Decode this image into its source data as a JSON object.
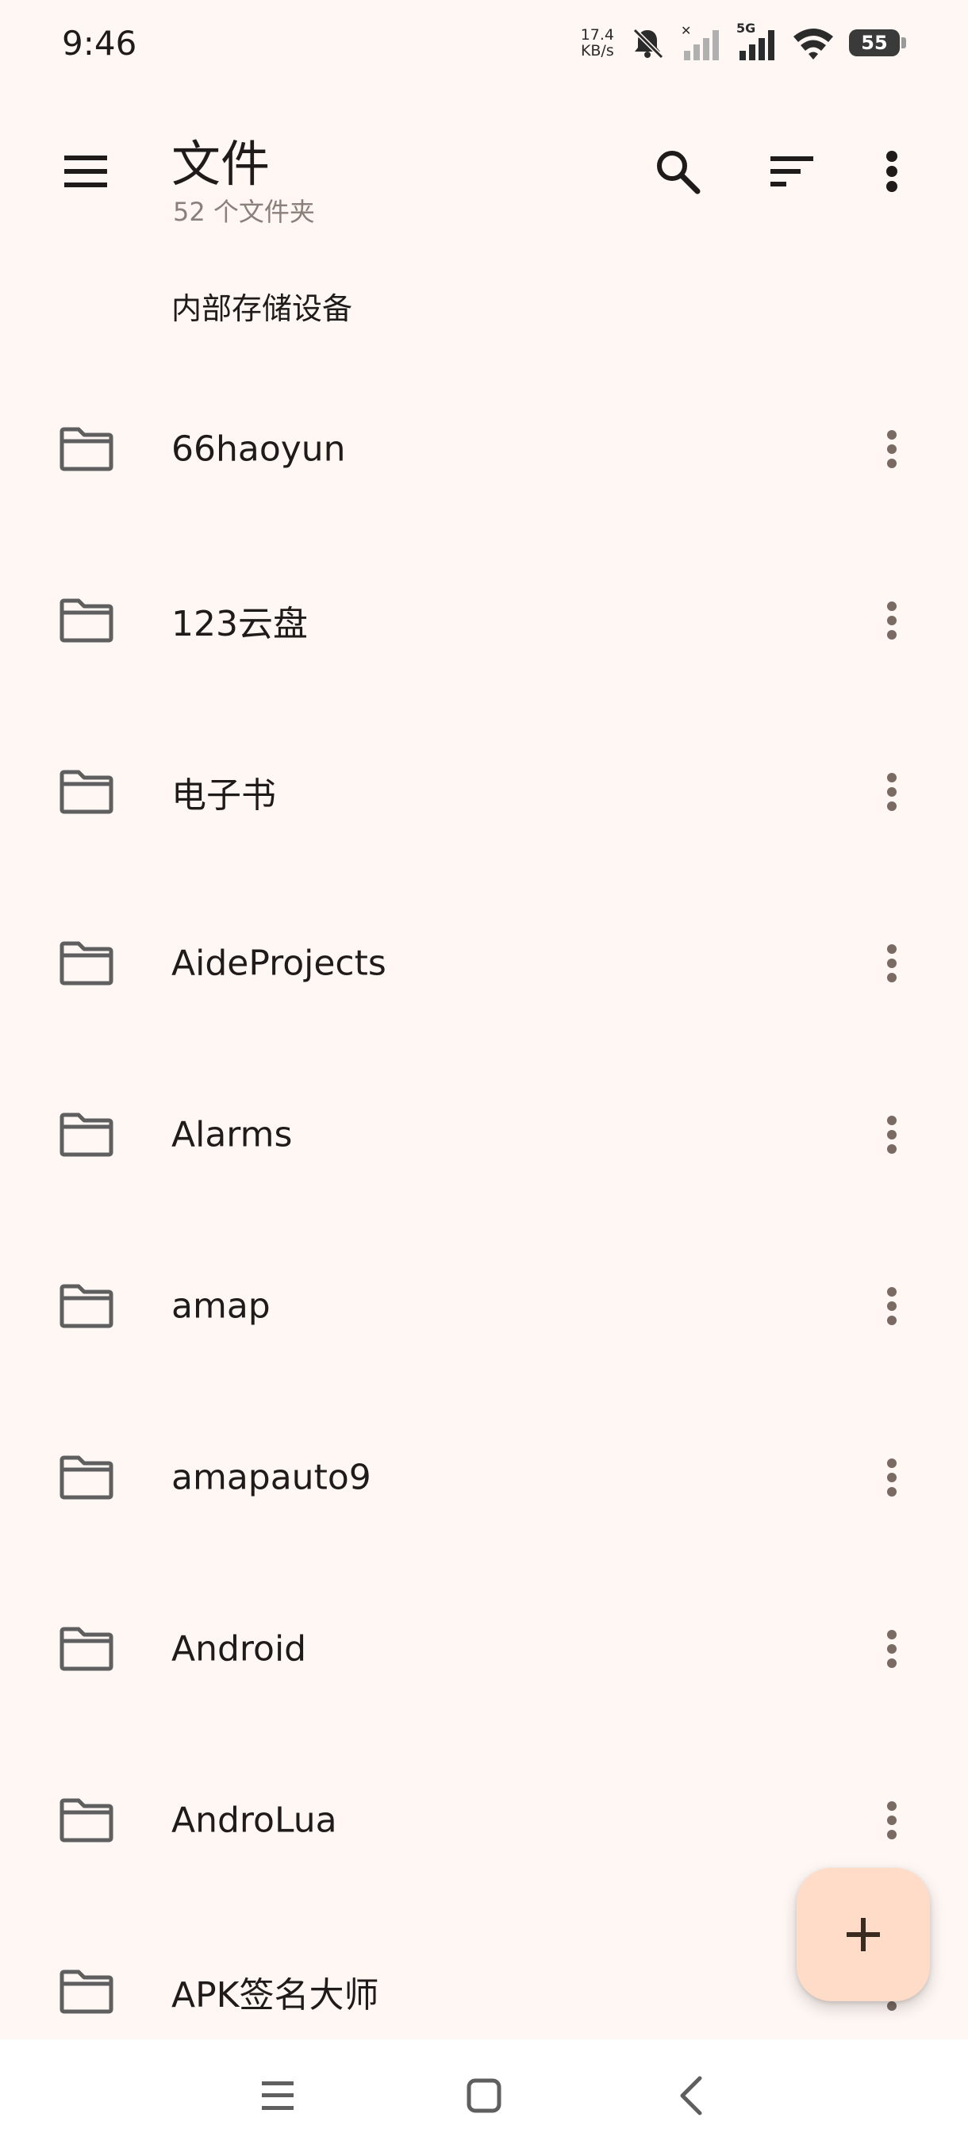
{
  "status_bar": {
    "time": "9:46",
    "net_speed_value": "17.4",
    "net_speed_unit": "KB/s",
    "network_type": "5G",
    "battery": "55"
  },
  "app_bar": {
    "title": "文件",
    "subtitle": "52 个文件夹"
  },
  "section": {
    "header": "内部存储设备"
  },
  "folders": [
    {
      "label": "66haoyun"
    },
    {
      "label": "123云盘"
    },
    {
      "label": "电子书"
    },
    {
      "label": "AideProjects"
    },
    {
      "label": "Alarms"
    },
    {
      "label": "amap"
    },
    {
      "label": "amapauto9"
    },
    {
      "label": "Android"
    },
    {
      "label": "AndroLua"
    },
    {
      "label": "APK签名大师"
    }
  ],
  "icons": {
    "menu": "hamburger-icon",
    "search": "search-icon",
    "sort": "sort-icon",
    "more": "more-vert-icon",
    "folder": "folder-icon",
    "fab": "add-icon"
  },
  "colors": {
    "background": "#fff7f4",
    "fab": "#ffdcc7",
    "text": "#1f1b1a",
    "secondary_text": "#8a7f7b",
    "icon": "#5f5f5f",
    "more_dots": "#7a6a62"
  }
}
